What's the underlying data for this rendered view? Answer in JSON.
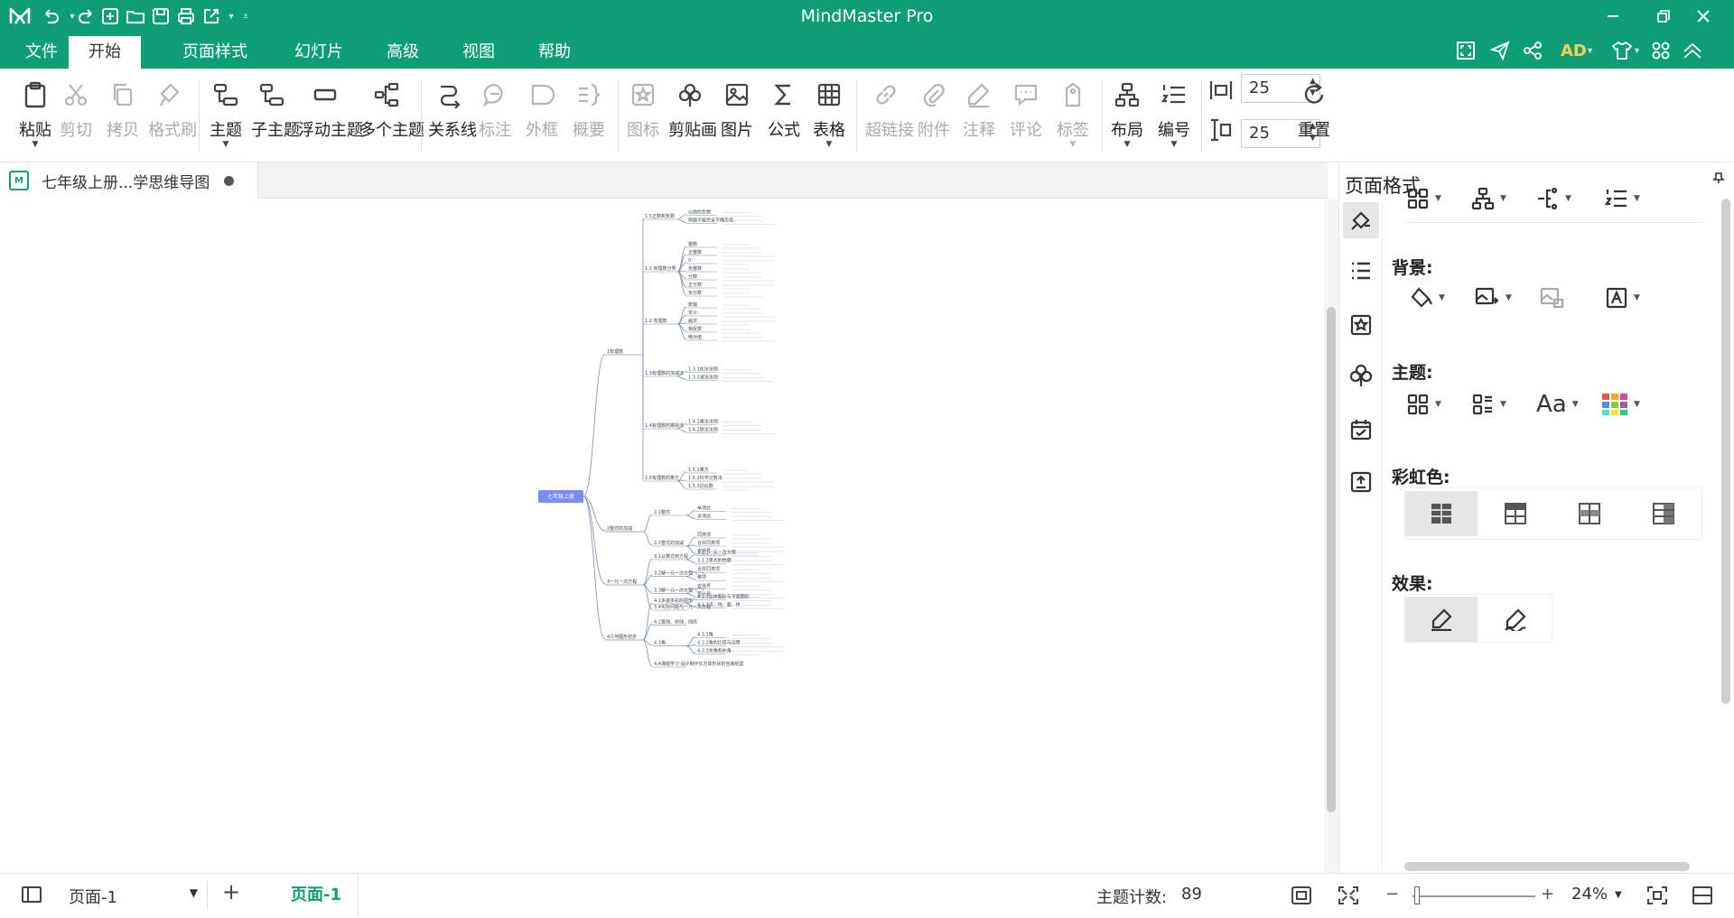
{
  "app": {
    "title": "MindMaster Pro",
    "accent": "#0e9e76"
  },
  "quick_access": {
    "icons": [
      "logo-icon",
      "undo-icon",
      "redo-icon",
      "new-icon",
      "open-icon",
      "save-icon",
      "print-icon",
      "export-icon",
      "more-icon"
    ]
  },
  "menu": {
    "tabs": [
      "文件",
      "开始",
      "页面样式",
      "幻灯片",
      "高级",
      "视图",
      "帮助"
    ],
    "active": "开始",
    "user_badge": "AD"
  },
  "ribbon": {
    "paste": "粘贴",
    "cut": "剪切",
    "copy": "拷贝",
    "format_painter": "格式刷",
    "topic": "主题",
    "subtopic": "子主题",
    "floating_topic": "浮动主题",
    "multiple_topics": "多个主题",
    "relationship": "关系线",
    "callout": "标注",
    "boundary": "外框",
    "summary": "概要",
    "icon": "图标",
    "clipart": "剪贴画",
    "picture": "图片",
    "formula": "公式",
    "table": "表格",
    "hyperlink": "超链接",
    "attachment": "附件",
    "note": "注释",
    "comment": "评论",
    "tag": "标签",
    "layout": "布局",
    "numbering": "编号",
    "h_spacing": "25",
    "v_spacing": "25",
    "reset": "重置"
  },
  "document": {
    "tab_title": "七年级上册...学思维导图"
  },
  "mindmap": {
    "root": "七年级上册",
    "branches": [
      {
        "label": "1有理数",
        "children": [
          {
            "label": "1.1正数和负数",
            "children": [
              "以前的负数",
              "例题不能完全不确定值"
            ]
          },
          {
            "label": "1.2 有理数分类",
            "children": [
              "整数",
              "正整数",
              "0",
              "负整数",
              "分数",
              "正分数",
              "负分数"
            ]
          },
          {
            "label": "1.2 有理数",
            "children": [
              "数轴",
              "定义",
              "画法",
              "相反数",
              "绝对值"
            ]
          },
          {
            "label": "1.3有理数的加减法",
            "children": [
              "1.3.1加法法则",
              "1.3.2减法法则"
            ]
          },
          {
            "label": "1.4有理数的乘除法",
            "children": [
              "1.4.1乘法法则",
              "1.4.2除法法则"
            ]
          },
          {
            "label": "1.5有理数的乘方",
            "children": [
              "1.5.1乘方",
              "1.5.2科学记数法",
              "1.5.3近似数"
            ]
          }
        ]
      },
      {
        "label": "2整式的加减",
        "children": [
          {
            "label": "2.1整式",
            "children": [
              "单项式",
              "多项式"
            ]
          },
          {
            "label": "2.2整式的加减",
            "children": [
              "同类项",
              "合并同类项",
              "去括号"
            ]
          }
        ]
      },
      {
        "label": "3一元一次方程",
        "children": [
          {
            "label": "3.1从算式到方程",
            "children": [
              "3.1.1一元一次方程",
              "3.1.2等式的性质"
            ]
          },
          {
            "label": "3.2解一元一次方程（一）",
            "children": [
              "合并同类项",
              "移项"
            ]
          },
          {
            "label": "3.3解一元一次方程（二）",
            "children": [
              "去括号",
              "去分母"
            ]
          },
          {
            "label": "3.4实际问题与一元一次方程",
            "children": []
          }
        ]
      },
      {
        "label": "4几何图形初步",
        "children": [
          {
            "label": "4.1多姿多彩的图形",
            "children": [
              "4.1.1立体图形与平面图形",
              "4.1.2点、线、面、体"
            ]
          },
          {
            "label": "4.2直线、射线、线段",
            "children": []
          },
          {
            "label": "4.3角",
            "children": [
              "4.3.1角",
              "4.3.2角的比较与运算",
              "4.3.3余角和补角"
            ]
          },
          {
            "label": "4.4课题学习 设计制作长方体形状的包装纸盒",
            "children": []
          }
        ]
      }
    ]
  },
  "panel": {
    "title": "页面格式",
    "background_label": "背景:",
    "theme_label": "主题:",
    "rainbow_label": "彩虹色:",
    "effect_label": "效果:",
    "theme_font": "Aa"
  },
  "status": {
    "page_select": "页面-1",
    "page_tab": "页面-1",
    "topic_count_label": "主题计数:",
    "topic_count": "89",
    "zoom_minus": "−",
    "zoom_plus": "+",
    "zoom": "24%",
    "zoom_level": 0.24
  }
}
